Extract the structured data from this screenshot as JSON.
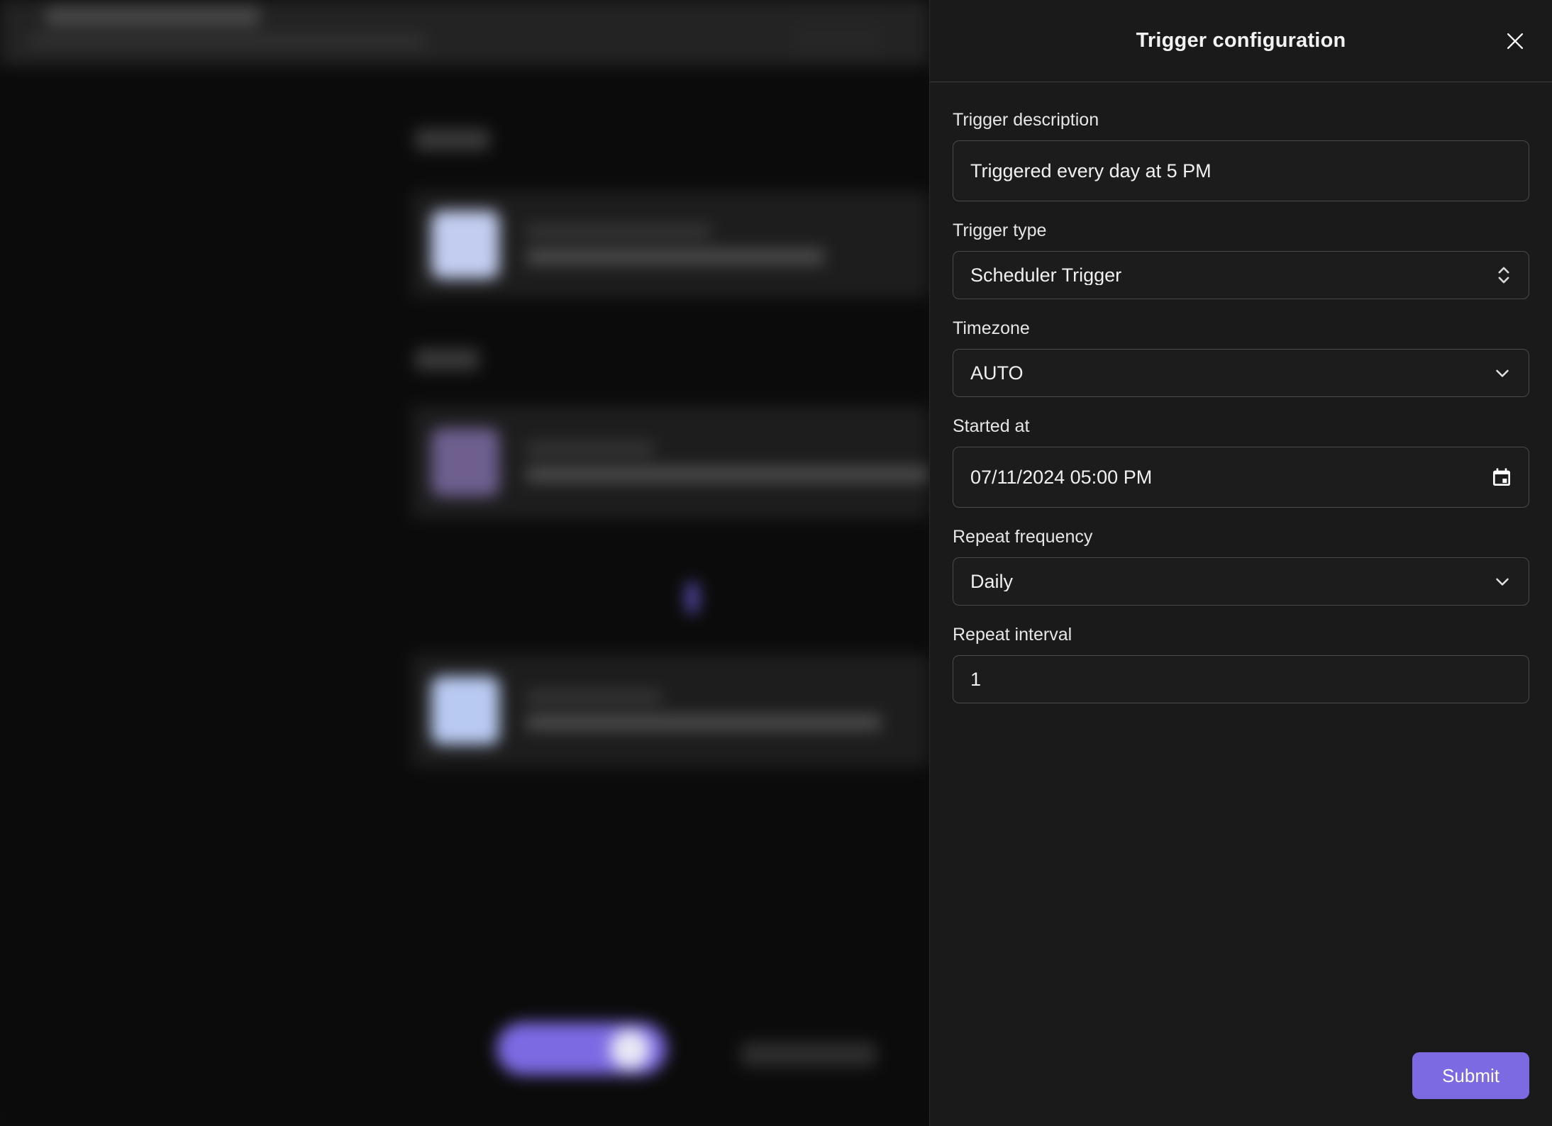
{
  "panel": {
    "title": "Trigger configuration",
    "close_icon": "close-icon",
    "fields": {
      "trigger_description": {
        "label": "Trigger description",
        "value": "Triggered every day at 5 PM",
        "placeholder": "Trigger description"
      },
      "trigger_type": {
        "label": "Trigger type",
        "value": "Scheduler Trigger",
        "icon": "chevron-up-down-icon"
      },
      "timezone": {
        "label": "Timezone",
        "value": "AUTO",
        "icon": "chevron-down-icon"
      },
      "started_at": {
        "label": "Started at",
        "value": "07/11/2024 05:00 PM",
        "icon": "calendar-icon"
      },
      "repeat_frequency": {
        "label": "Repeat frequency",
        "value": "Daily",
        "icon": "chevron-down-icon"
      },
      "repeat_interval": {
        "label": "Repeat interval",
        "value": "1",
        "placeholder": "Repeat interval"
      }
    },
    "submit_label": "Submit",
    "accent_color": "#7c6ae3",
    "background_color": "#1a1a1a"
  },
  "background": {
    "blurred": true,
    "sections": [
      {
        "icon_color": "#c3cdf0"
      },
      {
        "icon_color": "#6e5f8f"
      },
      {
        "icon_color": "#b9caf2"
      }
    ],
    "accent_color": "#7c6ae3"
  }
}
